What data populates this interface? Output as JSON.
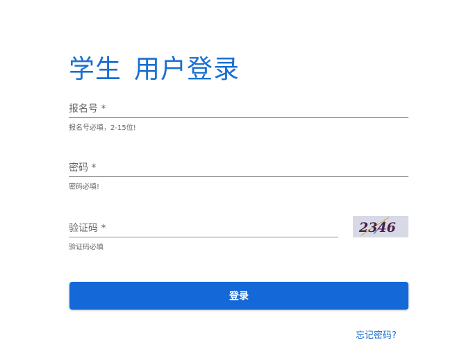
{
  "header": {
    "title_part1": "学生",
    "title_part2": "用户登录"
  },
  "form": {
    "registration_number": {
      "label": "报名号 *",
      "value": "",
      "hint": "报名号必填，2-15位!"
    },
    "password": {
      "label": "密码 *",
      "value": "",
      "hint": "密码必填!"
    },
    "captcha": {
      "label": "验证码 *",
      "value": "",
      "hint": "验证码必填",
      "image_text": "2346"
    },
    "submit_label": "登录",
    "forgot_password_label": "忘记密码?"
  },
  "colors": {
    "accent": "#1468d8",
    "title": "#1a6fd1",
    "link": "#1a6fd1",
    "captcha_bg": "#d7d9e6"
  }
}
